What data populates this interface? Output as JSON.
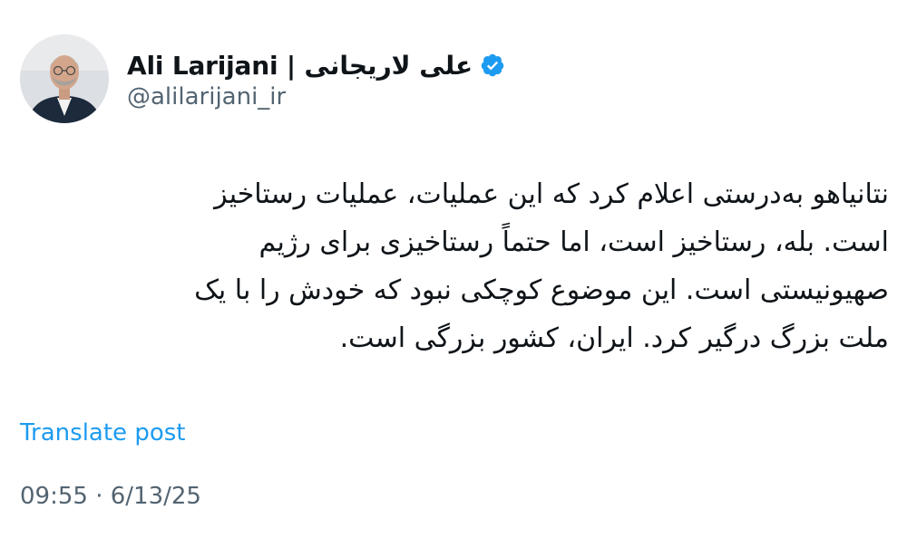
{
  "author": {
    "display_name": "Ali Larijani | علی لاریجانی",
    "handle": "@alilarijani_ir",
    "verified": true,
    "verified_color": "#1d9bf0"
  },
  "post": {
    "lines": [
      "نتانیاهو به‌درستی اعلام کرد که این عملیات، عملیات رستاخیز",
      "است. بله، رستاخیز است، اما حتماً رستاخیزی برای رژیم",
      "صهیونیستی است. این موضوع کوچکی نبود که خودش را با یک",
      "ملت بزرگ درگیر کرد. ایران، کشور بزرگی است."
    ],
    "translate_label": "Translate post",
    "timestamp": "09:55 · 6/13/25"
  },
  "colors": {
    "text": "#0f1419",
    "secondary": "#536471",
    "link": "#1d9bf0"
  }
}
